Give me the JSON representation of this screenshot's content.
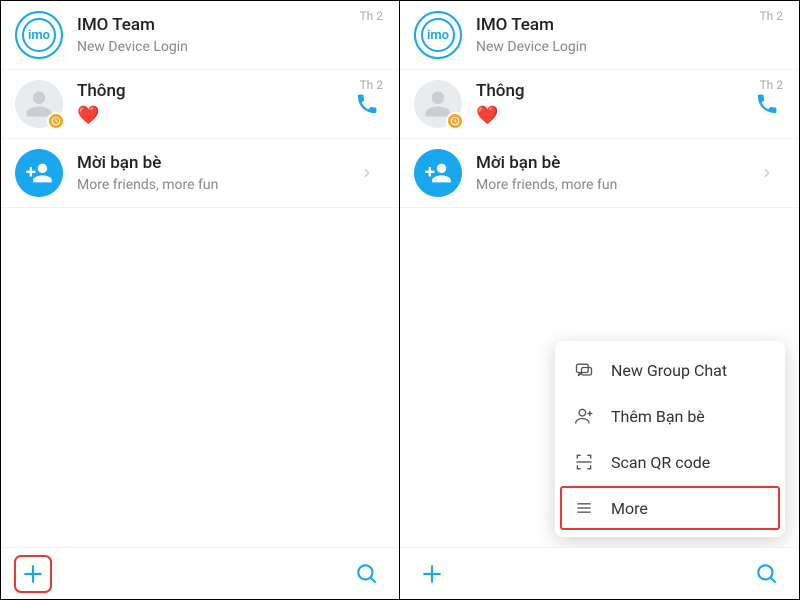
{
  "left": {
    "chats": [
      {
        "title": "IMO Team",
        "sub": "New Device Login",
        "time": "Th 2",
        "avatar": "imo",
        "action": "none"
      },
      {
        "title": "Thông",
        "sub": "❤️",
        "time": "Th 2",
        "avatar": "person",
        "badge": "clock",
        "action": "call"
      },
      {
        "title": "Mời bạn bè",
        "sub": "More friends, more fun",
        "time": "",
        "avatar": "addfriend",
        "action": "chevron"
      }
    ],
    "imo_label": "imo"
  },
  "right": {
    "chats": [
      {
        "title": "IMO Team",
        "sub": "New Device Login",
        "time": "Th 2",
        "avatar": "imo",
        "action": "none"
      },
      {
        "title": "Thông",
        "sub": "❤️",
        "time": "Th 2",
        "avatar": "person",
        "badge": "clock",
        "action": "call"
      },
      {
        "title": "Mời bạn bè",
        "sub": "More friends, more fun",
        "time": "",
        "avatar": "addfriend",
        "action": "chevron"
      }
    ],
    "imo_label": "imo",
    "menu": [
      {
        "label": "New Group Chat",
        "icon": "group"
      },
      {
        "label": "Thêm Bạn bè",
        "icon": "addperson"
      },
      {
        "label": "Scan QR code",
        "icon": "qr"
      },
      {
        "label": "More",
        "icon": "menu",
        "highlighted": true
      }
    ]
  },
  "colors": {
    "accent": "#19a7f0",
    "highlight": "#e53935"
  }
}
